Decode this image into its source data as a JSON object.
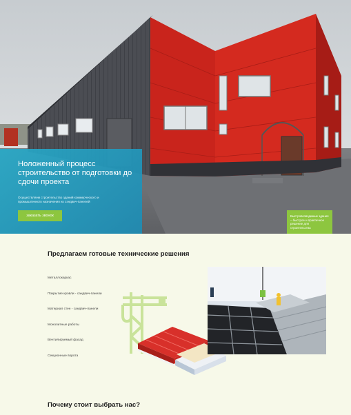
{
  "hero": {
    "title": "Ноложенный процесс строительство от подготовки до сдочи проекта",
    "subtitle": "Осуществляем строительство зданий коммерческого и промышленного назначения из сэндвич-панелей",
    "cta_label": "заказать звонок",
    "badge_text": "Быстровозводимые здания – быстрое и практичное решение для строительства"
  },
  "solutions": {
    "title": "Предлагаем готовые технические решения",
    "items": [
      "Металлокаркас",
      "Покрытие кровли - сандвич-панели",
      "Материал стен - сандвич-панели",
      "Монолитные работы",
      "Вентилируемый фасад",
      "Секционные ворота"
    ]
  },
  "why": {
    "title": "Почему стоит выбрать нас?"
  },
  "colors": {
    "accent": "#8dc63f",
    "card": "#2aa8c6",
    "page_bg": "#f7f9e9",
    "facade_red": "#c9241c",
    "facade_grey": "#4a4c52"
  }
}
